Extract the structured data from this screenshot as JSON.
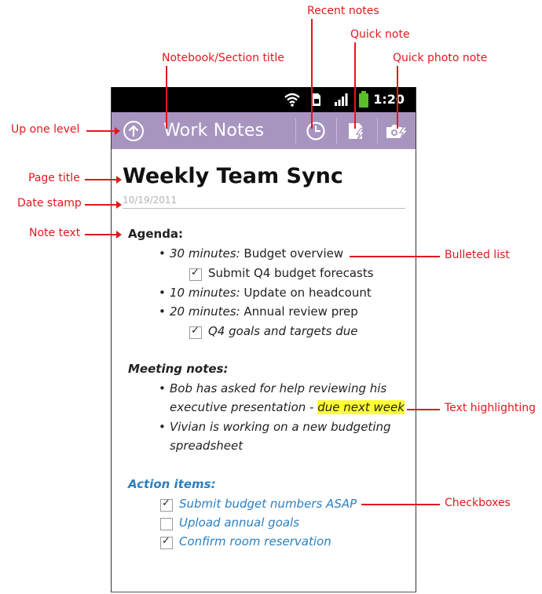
{
  "status_bar": {
    "time": "1:20",
    "icons": [
      "wifi-icon",
      "sim-icon",
      "signal-icon",
      "battery-icon"
    ]
  },
  "action_bar": {
    "up_icon": "up-circle-arrow-icon",
    "title": "Work Notes",
    "actions": [
      {
        "name": "recent-notes-button",
        "icon": "clock-icon"
      },
      {
        "name": "quick-note-button",
        "icon": "note-lightning-icon"
      },
      {
        "name": "quick-photo-note-button",
        "icon": "camera-lightning-icon"
      }
    ],
    "color": "#a795c0"
  },
  "page": {
    "title": "Weekly Team Sync",
    "date": "10/19/2011"
  },
  "note": {
    "agenda_heading": "Agenda:",
    "agenda": [
      {
        "time": "30 minutes:",
        "text": " Budget overview",
        "sub": {
          "checked": true,
          "text": "Submit Q4 budget forecasts",
          "italic": false
        }
      },
      {
        "time": "10 minutes:",
        "text": " Update on headcount"
      },
      {
        "time": "20 minutes:",
        "text": " Annual review prep",
        "sub": {
          "checked": true,
          "text": "Q4 goals and targets due",
          "italic": true
        }
      }
    ],
    "meeting_heading": "Meeting notes:",
    "meeting": [
      {
        "line1": "Bob has asked for help reviewing his",
        "line2_pre": "executive presentation - ",
        "line2_hl": "due next week"
      },
      {
        "line1": "Vivian is working on a new budgeting",
        "line2": "spreadsheet"
      }
    ],
    "action_heading": "Action items:",
    "actions": [
      {
        "checked": true,
        "text": "Submit budget numbers ASAP"
      },
      {
        "checked": false,
        "text": "Upload annual goals"
      },
      {
        "checked": true,
        "text": "Confirm room reservation"
      }
    ],
    "highlight_color": "#ffff33",
    "action_color": "#2c7fc0"
  },
  "annotations": {
    "recent_notes": "Recent notes",
    "quick_note": "Quick note",
    "quick_photo_note": "Quick photo note",
    "notebook_title": "Notebook/Section title",
    "up_one_level": "Up one level",
    "page_title": "Page title",
    "date_stamp": "Date stamp",
    "note_text": "Note text",
    "bulleted_list": "Bulleted list",
    "text_highlighting": "Text highlighting",
    "checkboxes": "Checkboxes",
    "color": "#e0191e"
  }
}
